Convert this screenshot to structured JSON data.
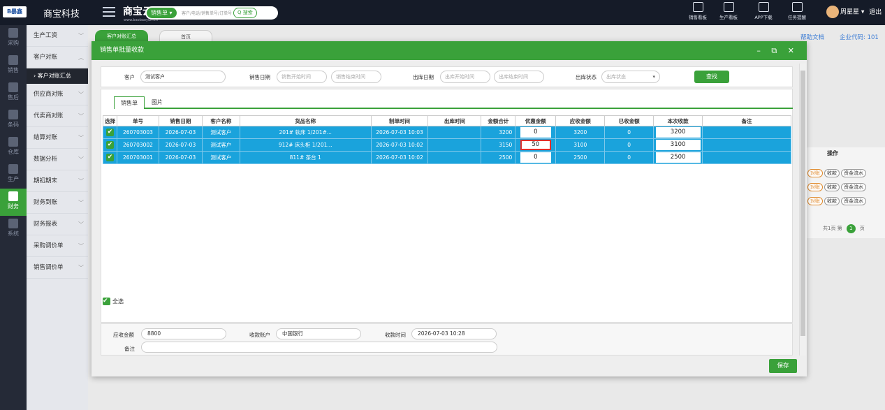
{
  "topbar": {
    "logo_text": "B暴鑫",
    "company": "商宝科技",
    "brand": "商宝云",
    "brand_sub": "www.baobaoyun.cn",
    "search_type": "销售单 ▾",
    "search_placeholder": "客户/电话/销售单号/订单号",
    "search_button": "Q 搜索",
    "tools": [
      {
        "label": "销售看板",
        "icon": "chart-icon"
      },
      {
        "label": "生产看板",
        "icon": "chart-icon"
      },
      {
        "label": "APP下载",
        "icon": "qr-icon"
      },
      {
        "label": "任务提醒",
        "icon": "flag-icon"
      }
    ],
    "user": "周星星 ▾",
    "logout": "退出"
  },
  "rail": [
    {
      "label": "采购"
    },
    {
      "label": "销售"
    },
    {
      "label": "售后"
    },
    {
      "label": "条码"
    },
    {
      "label": "仓库"
    },
    {
      "label": "生产"
    },
    {
      "label": "财务"
    },
    {
      "label": "系统"
    }
  ],
  "sidebar": {
    "items": [
      {
        "label": "生产工资"
      },
      {
        "label": "客户对账"
      },
      {
        "label": "供应商对账"
      },
      {
        "label": "代卖商对账"
      },
      {
        "label": "结算对账"
      },
      {
        "label": "数据分析"
      },
      {
        "label": "期初期末"
      },
      {
        "label": "财务到账"
      },
      {
        "label": "财务报表"
      },
      {
        "label": "采购调价单"
      },
      {
        "label": "销售调价单"
      }
    ],
    "sub_item": "› 客户对账汇总"
  },
  "main": {
    "tabs": [
      "客户对账汇总",
      "首页"
    ],
    "help": "帮助文档",
    "company_code": "企业代码: 101",
    "op_header": "操作",
    "pills": [
      "对账",
      "收款",
      "资金流水"
    ],
    "pager": {
      "total": "共1页 第",
      "current": "1",
      "suffix": "页"
    }
  },
  "modal": {
    "title": "销售单批量收款",
    "controls": "– ⧉ ✕",
    "filter": {
      "customer_label": "客户",
      "customer_value": "测试客户",
      "sale_date_label": "销售日期",
      "sale_start_ph": "销售开始时间",
      "sale_end_ph": "销售结束时间",
      "out_date_label": "出库日期",
      "out_start_ph": "出库开始时间",
      "out_end_ph": "出库结束时间",
      "out_status_label": "出库状态",
      "out_status_ph": "出库状态",
      "find_button": "查找"
    },
    "tabs": [
      "销售单",
      "图片"
    ],
    "columns": [
      "选择",
      "单号",
      "销售日期",
      "客户名称",
      "货品名称",
      "制单时间",
      "出库时间",
      "金额合计",
      "优惠金额",
      "应收金额",
      "已收金额",
      "本次收款",
      "备注"
    ],
    "rows": [
      {
        "no": "260703003",
        "date": "2026-07-03",
        "customer": "测试客户",
        "goods": "201# 软床 1/201#...",
        "created": "2026-07-03 10:03",
        "out": "",
        "total": "3200",
        "discount": "0",
        "receivable": "3200",
        "received": "0",
        "this": "3200",
        "note": ""
      },
      {
        "no": "260703002",
        "date": "2026-07-03",
        "customer": "测试客户",
        "goods": "912# 床头柜 1/201...",
        "created": "2026-07-03 10:02",
        "out": "",
        "total": "3150",
        "discount": "50",
        "receivable": "3100",
        "received": "0",
        "this": "3100",
        "note": ""
      },
      {
        "no": "260703001",
        "date": "2026-07-03",
        "customer": "测试客户",
        "goods": "811# 茶台 1",
        "created": "2026-07-03 10:02",
        "out": "",
        "total": "2500",
        "discount": "0",
        "receivable": "2500",
        "received": "0",
        "this": "2500",
        "note": ""
      }
    ],
    "select_all": "全选",
    "footer": {
      "receivable_label": "应收金额",
      "receivable_value": "8800",
      "account_label": "收款账户",
      "account_value": "中国银行",
      "time_label": "收款时间",
      "time_value": "2026-07-03 10:28",
      "note_label": "备注",
      "note_value": ""
    },
    "save_button": "保存"
  },
  "colors": {
    "accent": "#3aa13a",
    "row_selected": "#1aa3dc",
    "highlight": "#e0302c",
    "topbar": "#151b28"
  }
}
